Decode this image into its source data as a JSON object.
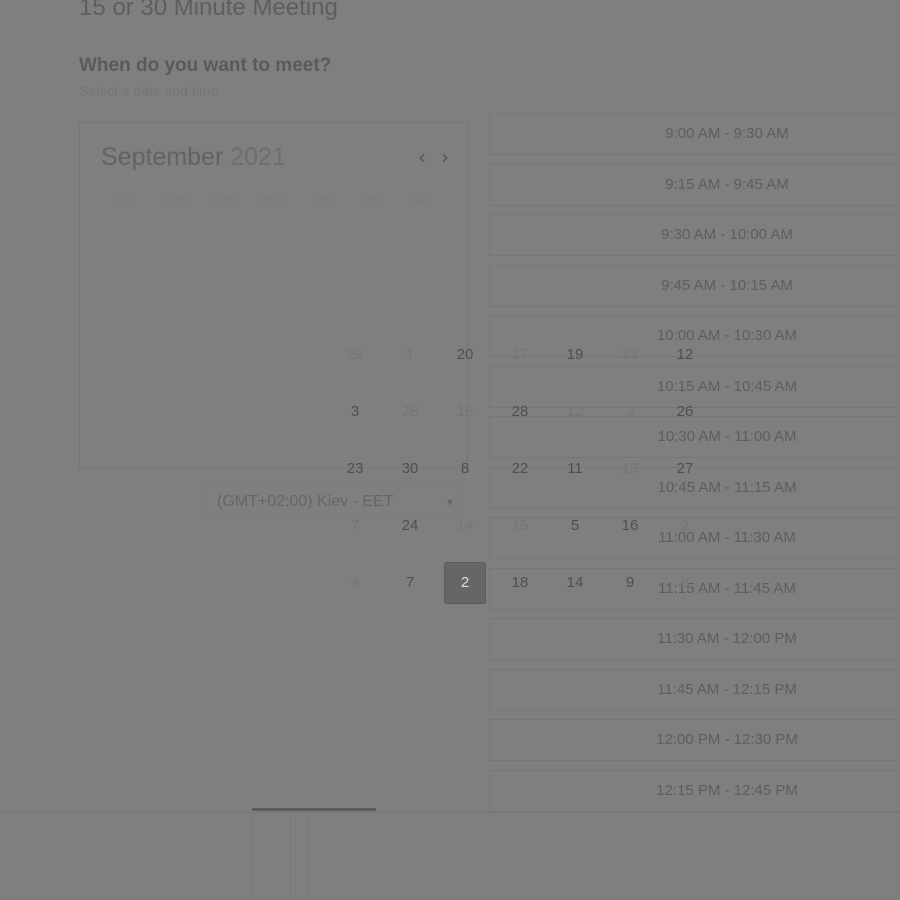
{
  "page": {
    "title": "15 or 30 Minute Meeting"
  },
  "booking": {
    "heading": "When do you want to meet?",
    "subheading": "Select a date and time"
  },
  "calendar": {
    "month": "September",
    "year": "2021",
    "prev_icon": "chevron-left-icon",
    "next_icon": "chevron-right-icon",
    "weekdays": [
      "SUN",
      "MON",
      "TUE",
      "WED",
      "THU",
      "FRI",
      "SAT"
    ],
    "days": [
      {
        "label": "29",
        "muted": true
      },
      {
        "label": "1",
        "muted": true
      },
      {
        "label": "20",
        "muted": false
      },
      {
        "label": "17",
        "muted": true
      },
      {
        "label": "19",
        "muted": false
      },
      {
        "label": "23",
        "muted": true
      },
      {
        "label": "12",
        "muted": false
      },
      {
        "label": "3",
        "muted": false
      },
      {
        "label": "28",
        "muted": true
      },
      {
        "label": "15",
        "muted": true
      },
      {
        "label": "28",
        "muted": false
      },
      {
        "label": "12",
        "muted": true
      },
      {
        "label": "2",
        "muted": true
      },
      {
        "label": "26",
        "muted": false
      },
      {
        "label": "23",
        "muted": false
      },
      {
        "label": "30",
        "muted": false
      },
      {
        "label": "8",
        "muted": false
      },
      {
        "label": "22",
        "muted": false
      },
      {
        "label": "11",
        "muted": false
      },
      {
        "label": "13",
        "muted": true
      },
      {
        "label": "27",
        "muted": false
      },
      {
        "label": "7",
        "muted": true
      },
      {
        "label": "24",
        "muted": false
      },
      {
        "label": "14",
        "muted": true
      },
      {
        "label": "15",
        "muted": true
      },
      {
        "label": "5",
        "muted": false
      },
      {
        "label": "16",
        "muted": false
      },
      {
        "label": "2",
        "muted": true
      },
      {
        "label": "4",
        "muted": true
      },
      {
        "label": "7",
        "muted": false
      },
      {
        "label": "2",
        "muted": false,
        "selected": true
      },
      {
        "label": "18",
        "muted": false
      },
      {
        "label": "14",
        "muted": false
      },
      {
        "label": "9",
        "muted": false
      },
      {
        "label": "8",
        "muted": true
      }
    ]
  },
  "timezone": {
    "value": "(GMT+02:00) Kiev - EET",
    "caret_icon": "chevron-down-icon"
  },
  "timeslots": [
    "9:00 AM - 9:30 AM",
    "9:15 AM - 9:45 AM",
    "9:30 AM - 10:00 AM",
    "9:45 AM - 10:15 AM",
    "10:00 AM - 10:30 AM",
    "10:15 AM - 10:45 AM",
    "10:30 AM - 11:00 AM",
    "10:45 AM - 11:15 AM",
    "11:00 AM - 11:30 AM",
    "11:15 AM - 11:45 AM",
    "11:30 AM - 12:00 PM",
    "11:45 AM - 12:15 PM",
    "12:00 PM - 12:30 PM",
    "12:15 PM - 12:45 PM"
  ],
  "scroll_progress": 0.5
}
